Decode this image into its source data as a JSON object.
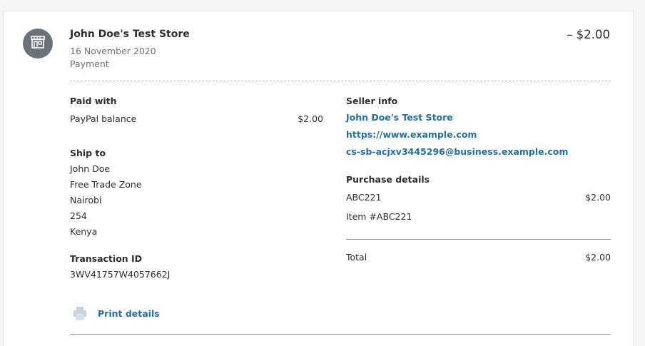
{
  "header": {
    "merchant": "John Doe's Test Store",
    "date": "16 November 2020",
    "type": "Payment",
    "amount": "– $2.00"
  },
  "paid_with": {
    "label": "Paid with",
    "method": "PayPal balance",
    "amount": "$2.00"
  },
  "ship_to": {
    "label": "Ship to",
    "lines": [
      "John Doe",
      "Free Trade Zone",
      "Nairobi",
      "254",
      "Kenya"
    ]
  },
  "transaction": {
    "label": "Transaction ID",
    "id": "3WV41757W4057662J"
  },
  "print": {
    "label": "Print details"
  },
  "seller": {
    "label": "Seller info",
    "name": "John Doe's Test Store",
    "website": "https://www.example.com",
    "email": "cs-sb-acjxv3445296@business.example.com"
  },
  "purchase": {
    "label": "Purchase details",
    "item_name": "ABC221",
    "item_amount": "$2.00",
    "item_number": "Item #ABC221",
    "total_label": "Total",
    "total_amount": "$2.00"
  },
  "icons": {
    "avatar": "store-icon",
    "print": "printer-icon"
  },
  "colors": {
    "link": "#1f6fa8",
    "avatar_bg": "#6c7378",
    "muted_text": "#6c7378"
  }
}
